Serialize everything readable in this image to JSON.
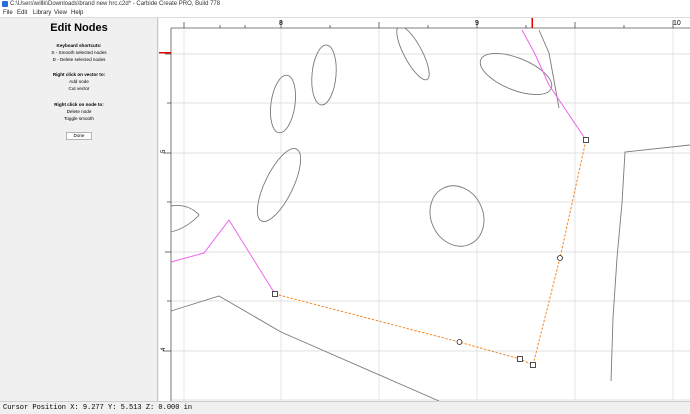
{
  "window": {
    "title": "C:\\Users\\willk\\Downloads\\brand new hrc.c2d* - Carbide Create PRO, Build 778"
  },
  "menu": {
    "items": [
      "File",
      "Edit",
      "Library",
      "View",
      "Help"
    ]
  },
  "panel": {
    "title": "Edit Nodes",
    "shortcuts_heading": "Keyboard shortcuts:",
    "shortcuts": [
      "S - Smooth selected nodes",
      "D - Delete selected nodes"
    ],
    "vector_heading": "Right click on vector to:",
    "vector_actions": [
      "Add node",
      "Cut vector"
    ],
    "node_heading": "Right click on node to:",
    "node_actions": [
      "Delete node",
      "Toggle smooth"
    ],
    "done_label": "Done"
  },
  "rulers": {
    "top_labels": [
      "8",
      "9",
      "10"
    ],
    "left_labels": [
      "5",
      "4"
    ]
  },
  "colors": {
    "selected_path": "#f08a2a",
    "connected_path": "#ee66ee",
    "other_paths": "#7a7a7a",
    "grid": "#d9d9d9",
    "cursor_marker": "#dd0000"
  },
  "status": {
    "cursor_position": "Cursor Position X: 9.277 Y: 5.513 Z: 0.000 in"
  }
}
